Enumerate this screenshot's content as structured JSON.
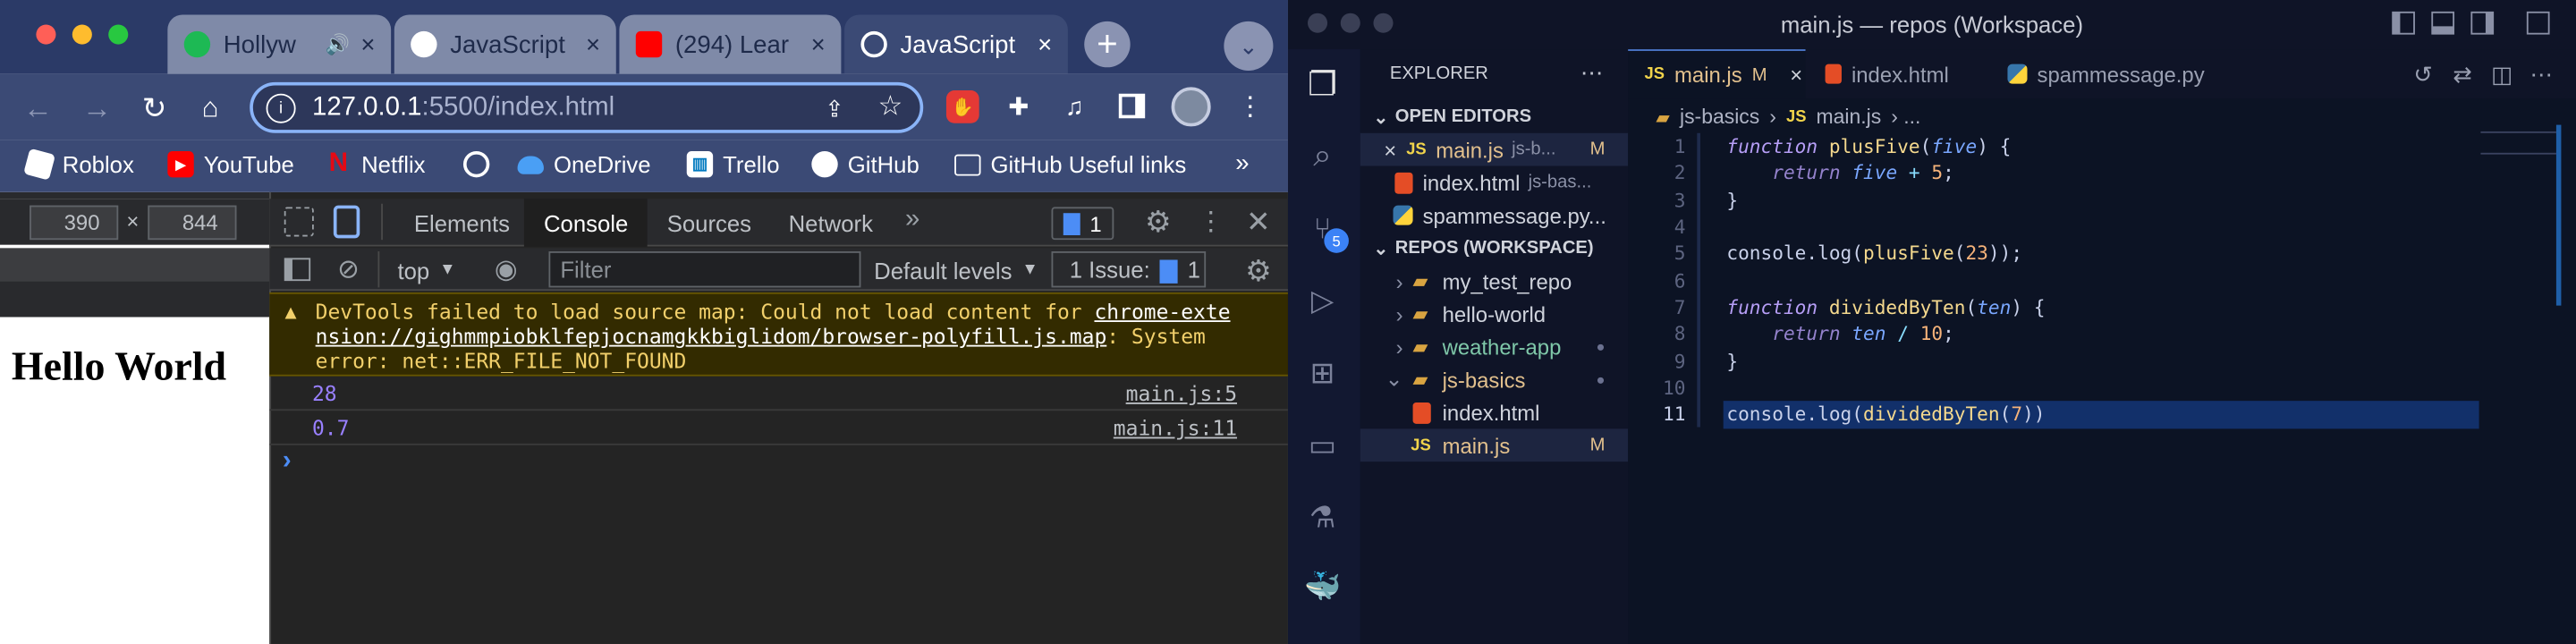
{
  "colors": {
    "chrome_tabbar": "#2b3a67",
    "chrome_toolbar": "#3b4a75",
    "devtools_bg": "#242424",
    "warning_bg": "#332b00",
    "vscode_bg": "#0f1427",
    "editor_bg": "#0c1324",
    "accent": "#4d78cc"
  },
  "chrome": {
    "tabs": [
      {
        "label": "Hollyw"
      },
      {
        "label": "JavaScript"
      },
      {
        "label": "(294) Lear"
      },
      {
        "label": "JavaScript"
      }
    ],
    "url_host": "127.0.0.1",
    "url_rest": ":5500/index.html",
    "bookmarks": [
      {
        "label": "Roblox"
      },
      {
        "label": "YouTube"
      },
      {
        "label": "Netflix"
      },
      {
        "label": ""
      },
      {
        "label": "OneDrive"
      },
      {
        "label": "Trello"
      },
      {
        "label": "GitHub"
      },
      {
        "label": "GitHub Useful links"
      }
    ],
    "more_bookmarks": "»",
    "page": {
      "width": "390",
      "height": "844",
      "heading": "Hello World",
      "times": "×"
    },
    "devtools": {
      "tabs": [
        "Elements",
        "Console",
        "Sources",
        "Network"
      ],
      "more": "»",
      "msg_badge": "1",
      "context": "top",
      "filter_placeholder": "Filter",
      "levels": "Default levels",
      "issues_label": "1 Issue:",
      "issues_count": "1",
      "warning": {
        "prefix": "DevTools failed to load source map: Could not load content for ",
        "link": "chrome-extension://gighmmpiobklfepjocnamgkkbiglidom/browser-polyfill.js.map",
        "suffix": ": System error: net::ERR_FILE_NOT_FOUND"
      },
      "logs": [
        {
          "value": "28",
          "source": "main.js:5"
        },
        {
          "value": "0.7",
          "source": "main.js:11"
        }
      ],
      "prompt": "›"
    }
  },
  "vscode": {
    "title": "main.js — repos (Workspace)",
    "scm_badge": "5",
    "explorer": {
      "header": "EXPLORER",
      "open_editors_label": "OPEN EDITORS",
      "open_editors": [
        {
          "name": "main.js",
          "path": "js-b...",
          "status": "M",
          "close": "×"
        },
        {
          "name": "index.html",
          "path": "js-bas..."
        },
        {
          "name": "spammessage.py..."
        }
      ],
      "workspace_label": "REPOS (WORKSPACE)",
      "tree": [
        {
          "name": "my_test_repo"
        },
        {
          "name": "hello-world"
        },
        {
          "name": "weather-app",
          "dot": "●"
        },
        {
          "name": "js-basics",
          "dot": "●"
        },
        {
          "name": "index.html"
        },
        {
          "name": "main.js",
          "status": "M"
        }
      ]
    },
    "tabs": [
      {
        "label": "main.js",
        "status": "M",
        "close": "×",
        "icon": "JS"
      },
      {
        "label": "index.html"
      },
      {
        "label": "spammessage.py"
      }
    ],
    "breadcrumb": {
      "folder": "js-basics",
      "sep": "›",
      "file": "main.js",
      "more": "› ..."
    },
    "code": {
      "l1": {
        "kw": "function",
        "name": "plusFive",
        "p1": "(",
        "param": "five",
        "p2": ") {"
      },
      "l2": {
        "kw": "return",
        "param": "five",
        "op": "+",
        "num": "5",
        "end": ";"
      },
      "l3": "}",
      "l5": {
        "a": "console.log(",
        "fn": "plusFive",
        "b": "(",
        "num": "23",
        "c": "));"
      },
      "l7": {
        "kw": "function",
        "name": "dividedByTen",
        "p1": "(",
        "param": "ten",
        "p2": ") {"
      },
      "l8": {
        "kw": "return",
        "param": "ten",
        "op": "/",
        "num": "10",
        "end": ";"
      },
      "l9": "}",
      "l11": {
        "a": "console.log(",
        "fn": "dividedByTen",
        "b": "(",
        "num": "7",
        "c": "))"
      }
    }
  }
}
